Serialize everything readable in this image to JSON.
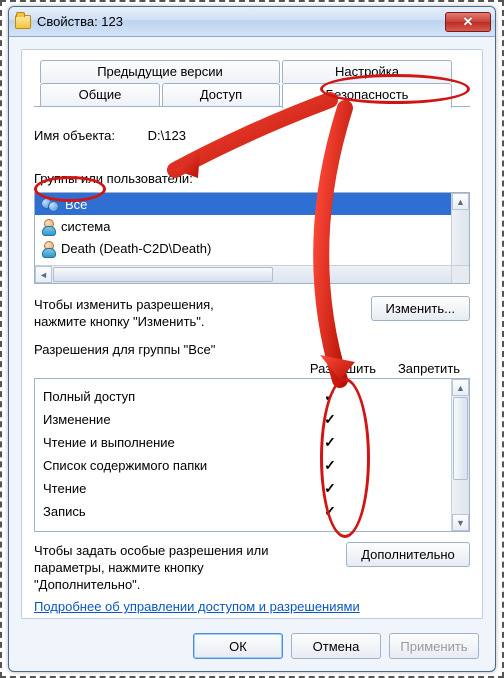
{
  "window": {
    "title": "Свойства: 123"
  },
  "tabs": {
    "prev_versions": "Предыдущие версии",
    "customize": "Настройка",
    "general": "Общие",
    "sharing": "Доступ",
    "security": "Безопасность"
  },
  "object_name": {
    "label": "Имя объекта:",
    "value": "D:\\123"
  },
  "groups_label": "Группы или пользователи:",
  "principals": [
    {
      "name": "Все",
      "icon": "users",
      "selected": true
    },
    {
      "name": "система",
      "icon": "user",
      "selected": false
    },
    {
      "name": "Death (Death-C2D\\Death)",
      "icon": "user",
      "selected": false
    }
  ],
  "edit": {
    "text_line1": "Чтобы изменить разрешения,",
    "text_line2": "нажмите кнопку \"Изменить\".",
    "button": "Изменить..."
  },
  "perm_for": "Разрешения для группы \"Все\"",
  "perm_headers": {
    "allow": "Разрешить",
    "deny": "Запретить"
  },
  "permissions": [
    {
      "name": "Полный доступ",
      "allow": true,
      "deny": false
    },
    {
      "name": "Изменение",
      "allow": true,
      "deny": false
    },
    {
      "name": "Чтение и выполнение",
      "allow": true,
      "deny": false
    },
    {
      "name": "Список содержимого папки",
      "allow": true,
      "deny": false
    },
    {
      "name": "Чтение",
      "allow": true,
      "deny": false
    },
    {
      "name": "Запись",
      "allow": true,
      "deny": false
    }
  ],
  "advanced": {
    "text_line1": "Чтобы задать особые разрешения или",
    "text_line2": "параметры, нажмите кнопку",
    "text_line3": "\"Дополнительно\".",
    "button": "Дополнительно"
  },
  "help_link": "Подробнее об управлении доступом и разрешениями",
  "dialog": {
    "ok": "ОК",
    "cancel": "Отмена",
    "apply": "Применить"
  }
}
